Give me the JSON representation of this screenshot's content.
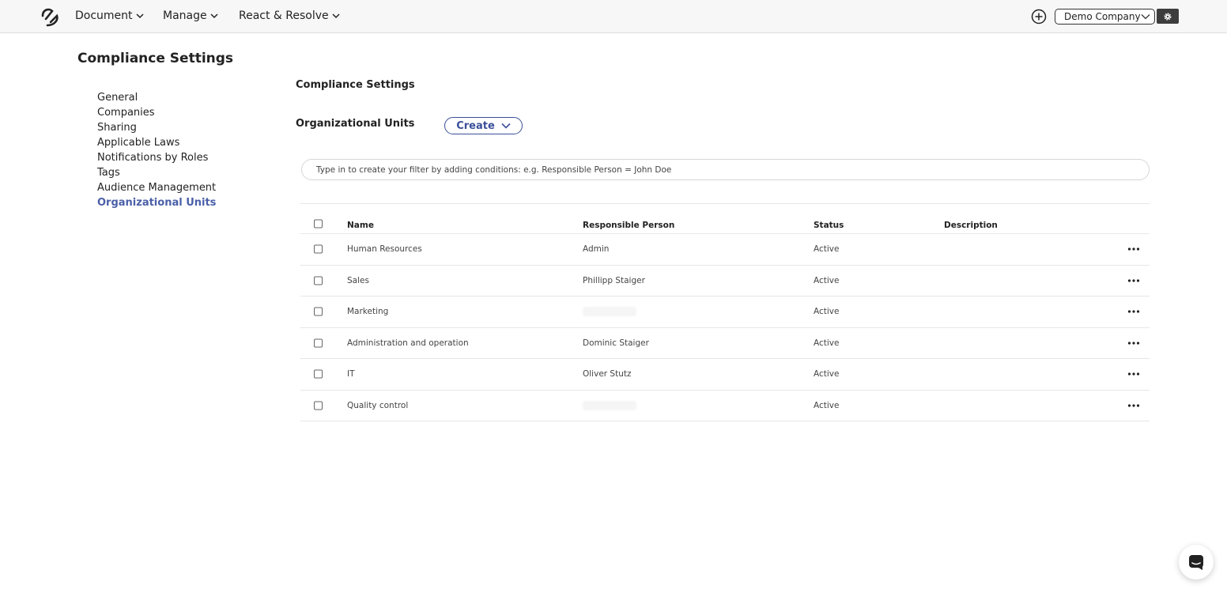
{
  "nav": {
    "items": [
      {
        "label": "Document"
      },
      {
        "label": "Manage"
      },
      {
        "label": "React & Resolve"
      }
    ],
    "company": "Demo Company"
  },
  "page": {
    "title": "Compliance Settings"
  },
  "sidebar": {
    "items": [
      {
        "label": "General"
      },
      {
        "label": "Companies"
      },
      {
        "label": "Sharing"
      },
      {
        "label": "Applicable Laws"
      },
      {
        "label": "Notifications by Roles"
      },
      {
        "label": "Tags"
      },
      {
        "label": "Audience Management"
      },
      {
        "label": "Organizational Units",
        "active": true
      }
    ]
  },
  "main": {
    "title": "Compliance Settings",
    "section_label": "Organizational Units",
    "create_label": "Create",
    "filter_placeholder": "Type in to create your filter by adding conditions: e.g. Responsible Person = John Doe"
  },
  "table": {
    "columns": {
      "name": "Name",
      "responsible": "Responsible Person",
      "status": "Status",
      "description": "Description"
    },
    "rows": [
      {
        "name": "Human Resources",
        "responsible": "Admin",
        "status": "Active",
        "description": ""
      },
      {
        "name": "Sales",
        "responsible": "Phillipp Staiger",
        "status": "Active",
        "description": ""
      },
      {
        "name": "Marketing",
        "responsible": "",
        "responsible_hidden": true,
        "status": "Active",
        "description": ""
      },
      {
        "name": "Administration and operation",
        "responsible": "Dominic Staiger",
        "status": "Active",
        "description": ""
      },
      {
        "name": "IT",
        "responsible": "Oliver Stutz",
        "status": "Active",
        "description": ""
      },
      {
        "name": "Quality control",
        "responsible": "",
        "responsible_hidden": true,
        "status": "Active",
        "description": ""
      }
    ]
  },
  "colors": {
    "accent": "#4a5fa8",
    "button_border": "#3b4f9a"
  }
}
